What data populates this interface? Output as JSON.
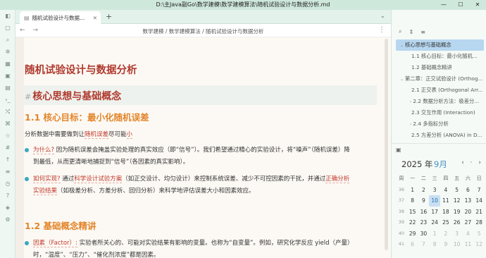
{
  "window": {
    "title": "D:\\主Java副Go\\数学建模\\数学建模算法\\随机试验设计与数据分析.md",
    "min": "—",
    "max": "☐",
    "close": "✕"
  },
  "tab": {
    "label": "随机试验设计与数据...",
    "close": "✕",
    "plus": "+",
    "chevron": "⌄"
  },
  "nav": {
    "back": "←",
    "forward": "→",
    "breadcrumb": "数学建模 / 数学建模算法 / 随机试验设计与数据分析",
    "more": "⋮"
  },
  "doc": {
    "h1": "随机试验设计与数据分析",
    "h2_hash": "#",
    "h2": "核心思想与基础概念",
    "h3_1": "1.1 核心目标：最小化随机误差",
    "p1_a": "分析数据中需要做到让",
    "p1_b": "随机误差",
    "p1_c": "尽可能",
    "p1_d": "小",
    "b1_a": "为什么?",
    "b1_b": "因为随机误差会掩盖实验处理的真实效应（即“信号”）。我们希望通过精心的实验设计，将“噪声”（随机误差）降",
    "b1_c": "到最低，从而更清晰地捕捉到“信号”（各因素的真实影响）。",
    "b2_a": "如何实现?",
    "b2_b": "通过",
    "b2_c": "科学设计试验方案",
    "b2_d": "（如正交设计、均匀设计）来控制系统误差、减少不可控因素的干扰，并通过",
    "b2_e": "正确分析",
    "b2_f": "实验结果",
    "b2_g": "（如极差分析、方差分析、回归分析）来科学地评估误差大小和因素效应。",
    "h3_2": "1.2 基础概念精讲",
    "b3_a": "因素（Factor）:",
    "b3_b": "实验者所关心的、可能对实验结果有影响的变量。也称为“自变量”。例如，研究化学反应 yield（产量）",
    "b3_c": "时，“温度”、“压力”、“催化剂浓度”都是因素。"
  },
  "outline": [
    {
      "label": "核心思想与基础概念",
      "level": 1,
      "active": true,
      "chev": "⌄"
    },
    {
      "label": "1.1 核心目标：最小化随机...",
      "level": 2,
      "active": false,
      "chev": ""
    },
    {
      "label": "1.2 基础概念精讲",
      "level": 2,
      "active": false,
      "chev": ""
    },
    {
      "label": "第二章：正交试验设计 (Orthog...",
      "level": 1,
      "active": false,
      "chev": "⌄"
    },
    {
      "label": "2.1 正交表 (Orthogonal Arr...",
      "level": 2,
      "active": false,
      "chev": ""
    },
    {
      "label": "2.2 数据分析方法：极差分...",
      "level": 2,
      "active": false,
      "chev": "›"
    },
    {
      "label": "2.3 交互作用 (Interaction)",
      "level": 2,
      "active": false,
      "chev": ""
    },
    {
      "label": "2.4 多指标分析",
      "level": 2,
      "active": false,
      "chev": "›"
    },
    {
      "label": "2.5 方差分析 (ANOVA) in D...",
      "level": 2,
      "active": false,
      "chev": ""
    }
  ],
  "calendar": {
    "year": "2025 年",
    "month": "9月",
    "nav": "‹ · ›",
    "weekday_headers": [
      "周",
      "一",
      "二",
      "三",
      "四",
      "五",
      "六",
      "日"
    ],
    "weeks": [
      [
        "36",
        "1",
        "2",
        "3",
        "4",
        "5",
        "6",
        "7"
      ],
      [
        "37",
        "8",
        "9",
        "10",
        "11",
        "12",
        "13",
        "14"
      ],
      [
        "38",
        "15",
        "16",
        "17",
        "18",
        "19",
        "20",
        "21"
      ],
      [
        "39",
        "22",
        "23",
        "24",
        "25",
        "26",
        "27",
        "28"
      ],
      [
        "40",
        "29",
        "30",
        "1",
        "2",
        "3",
        "4",
        "5"
      ],
      [
        "41",
        "6",
        "7",
        "8",
        "9",
        "10",
        "11",
        "12"
      ]
    ],
    "today": "10",
    "muted_after": "30"
  },
  "colors": {
    "heading": "#b03a2e",
    "subheading": "#e3852a",
    "accent": "#3aa8c1",
    "calendar_month": "#4a90c4"
  }
}
